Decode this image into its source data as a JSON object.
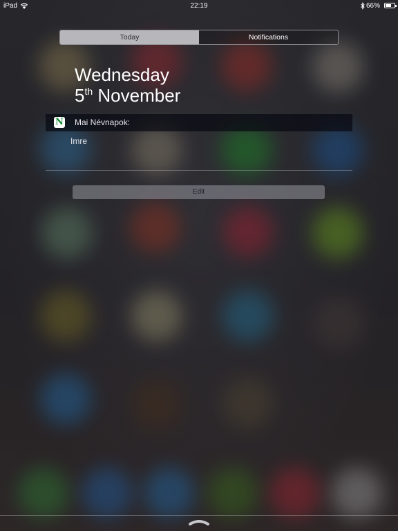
{
  "status_bar": {
    "device": "iPad",
    "time": "22:19",
    "battery_percent_label": "66%",
    "battery_level": 0.66,
    "icons": [
      "wifi-icon",
      "bluetooth-icon",
      "battery-icon"
    ]
  },
  "segmented_control": {
    "tabs": [
      {
        "label": "Today",
        "selected": true
      },
      {
        "label": "Notifications",
        "selected": false
      }
    ]
  },
  "today": {
    "weekday": "Wednesday",
    "day_number": "5",
    "day_suffix": "th",
    "month": "November"
  },
  "widget": {
    "icon_letter": "N",
    "title": "Mai Névnapok:",
    "body": "Imre",
    "icon_color": "#1c8c3a"
  },
  "edit_label": "Edit",
  "colors": {
    "selected_segment": "#b7b7bb",
    "widget_header": "#0a0c14"
  }
}
